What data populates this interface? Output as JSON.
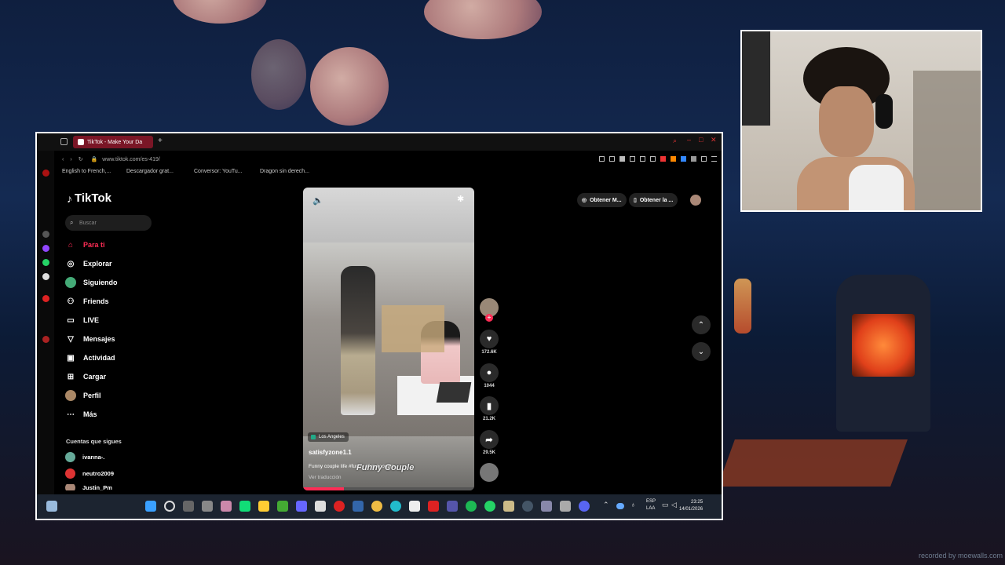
{
  "browser": {
    "tab_title": "TikTok - Make Your Da",
    "url": "www.tiktok.com/es-419/",
    "bookmarks": [
      "English to French,...",
      "Descargador grat...",
      "Conversor: YouTu...",
      "Dragon sin derech..."
    ]
  },
  "tiktok": {
    "logo": "TikTok",
    "search_placeholder": "Buscar",
    "nav": [
      {
        "label": "Para ti",
        "icon": "home-icon"
      },
      {
        "label": "Explorar",
        "icon": "compass-icon"
      },
      {
        "label": "Siguiendo",
        "icon": "avatar-icon"
      },
      {
        "label": "Friends",
        "icon": "users-icon"
      },
      {
        "label": "LIVE",
        "icon": "tv-icon"
      },
      {
        "label": "Mensajes",
        "icon": "send-icon"
      },
      {
        "label": "Actividad",
        "icon": "bell-icon"
      },
      {
        "label": "Cargar",
        "icon": "plus-icon"
      },
      {
        "label": "Perfil",
        "icon": "avatar-icon"
      },
      {
        "label": "Más",
        "icon": "more-icon"
      }
    ],
    "following_header": "Cuentas que sigues",
    "accounts": [
      "ivanna-.",
      "neutro2009",
      "Justin_Pm"
    ],
    "top_buttons": [
      "Obtener M...",
      "Obtener la ..."
    ],
    "video": {
      "location": "Los Angeles",
      "username": "satisfyzone1.1",
      "caption": "Funny couple life #funny #fyp #couple",
      "overlay_text": "Funny Couple",
      "translate": "Ver traducción"
    },
    "actions": {
      "likes": "172.6K",
      "comments": "1044",
      "saves": "21.2K",
      "shares": "29.5K"
    }
  },
  "taskbar": {
    "lang_top": "ESP",
    "lang_bottom": "LAA",
    "time": "23:25",
    "date": "14/01/2026"
  },
  "watermark": "recorded by moewalls.com",
  "colors": {
    "accent": "#fe2c55",
    "tab_bg": "#7a1626"
  }
}
